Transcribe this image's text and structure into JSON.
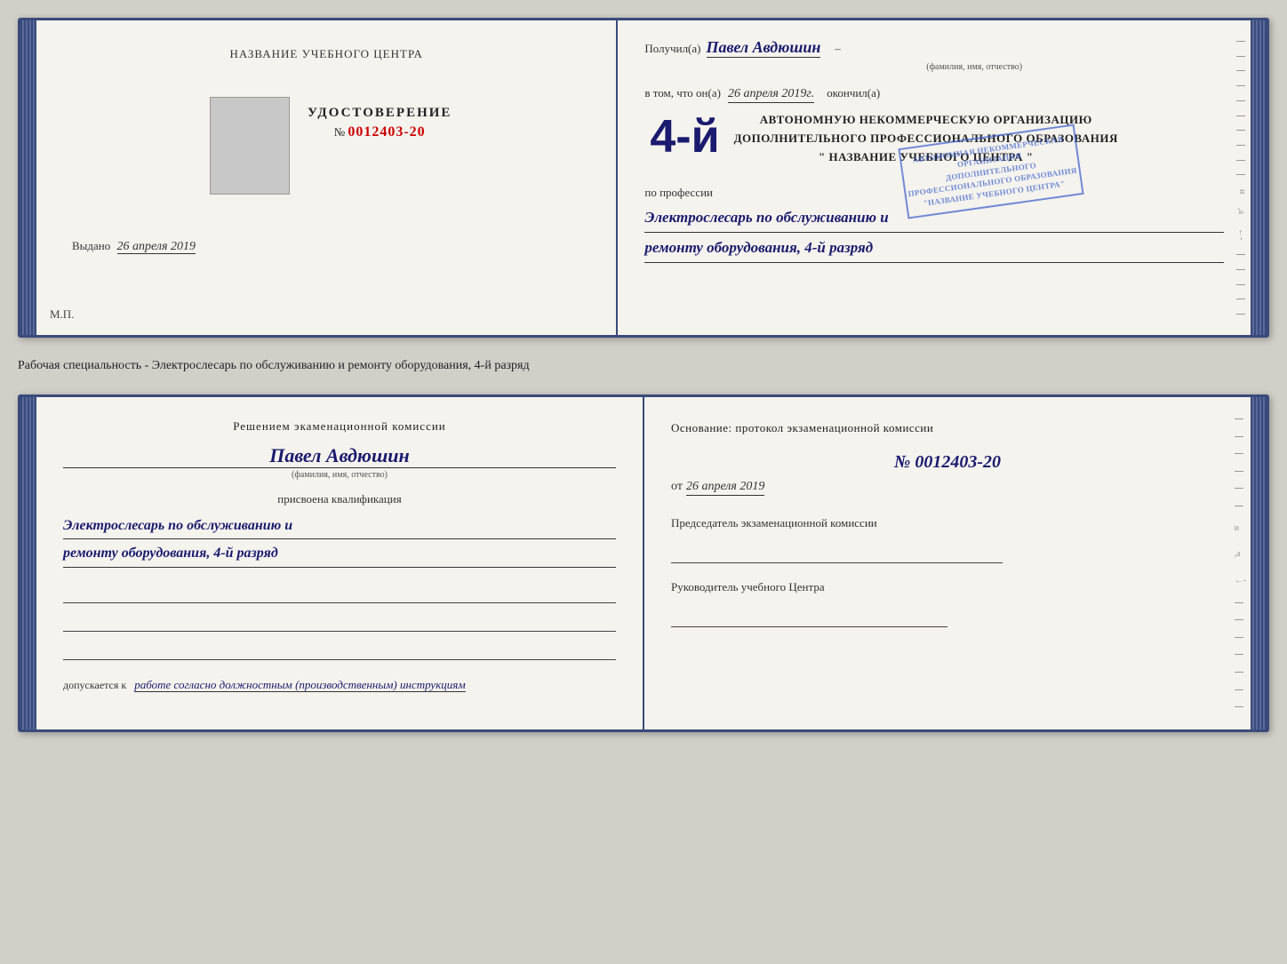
{
  "top_document": {
    "left": {
      "center_title": "НАЗВАНИЕ УЧЕБНОГО ЦЕНТРА",
      "cert_word": "УДОСТОВЕРЕНИЕ",
      "cert_number_label": "№",
      "cert_number": "0012403-20",
      "issued_label": "Выдано",
      "issued_date": "26 апреля 2019",
      "mp_label": "М.П."
    },
    "right": {
      "received_prefix": "Получил(а)",
      "person_name": "Павел Авдюшин",
      "fio_label": "(фамилия, имя, отчество)",
      "in_that_prefix": "в том, что он(а)",
      "date_value": "26 апреля 2019г.",
      "finished_label": "окончил(а)",
      "grade_badge": "4-й",
      "org_line1": "АВТОНОМНУЮ НЕКОММЕРЧЕСКУЮ ОРГАНИЗАЦИЮ",
      "org_line2": "ДОПОЛНИТЕЛЬНОГО ПРОФЕССИОНАЛЬНОГО ОБРАЗОВАНИЯ",
      "org_line3": "\" НАЗВАНИЕ УЧЕБНОГО ЦЕНТРА \"",
      "profession_label": "по профессии",
      "profession_line1": "Электрослесарь по обслуживанию и",
      "profession_line2": "ремонту оборудования, 4-й разряд"
    }
  },
  "specialty_label": "Рабочая специальность - Электрослесарь по обслуживанию и ремонту оборудования, 4-й разряд",
  "bottom_document": {
    "left": {
      "decision_title": "Решением экаменационной комиссии",
      "person_name": "Павел Авдюшин",
      "fio_label": "(фамилия, имя, отчество)",
      "qualification_assigned": "присвоена квалификация",
      "qualification_line1": "Электрослесарь по обслуживанию и",
      "qualification_line2": "ремонту оборудования, 4-й разряд",
      "allowed_label": "допускается к",
      "allowed_cursive": "работе согласно должностным (производственным) инструкциям"
    },
    "right": {
      "basis_title": "Основание: протокол экзаменационной комиссии",
      "protocol_number": "№ 0012403-20",
      "protocol_date_prefix": "от",
      "protocol_date": "26 апреля 2019",
      "commission_head_label": "Председатель экзаменационной комиссии",
      "center_head_label": "Руководитель учебного Центра"
    }
  }
}
